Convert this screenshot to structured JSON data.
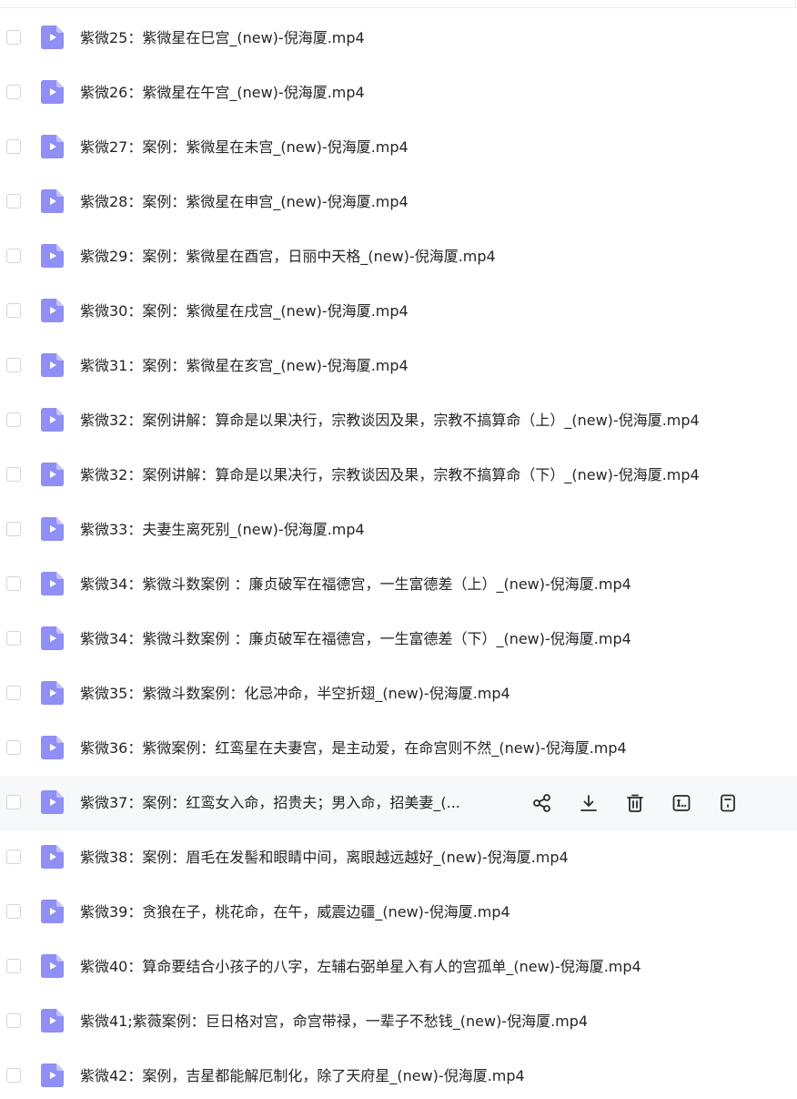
{
  "files": [
    {
      "name": "紫微25：紫微星在巳宫_(new)-倪海厦.mp4"
    },
    {
      "name": "紫微26：紫微星在午宫_(new)-倪海厦.mp4"
    },
    {
      "name": "紫微27：案例：紫微星在未宫_(new)-倪海厦.mp4"
    },
    {
      "name": "紫微28：案例：紫微星在申宫_(new)-倪海厦.mp4"
    },
    {
      "name": "紫微29：案例：紫微星在酉宫，日丽中天格_(new)-倪海厦.mp4"
    },
    {
      "name": "紫微30：案例：紫微星在戌宫_(new)-倪海厦.mp4"
    },
    {
      "name": "紫微31：案例：紫微星在亥宫_(new)-倪海厦.mp4"
    },
    {
      "name": "紫微32：案例讲解：算命是以果决行，宗教谈因及果，宗教不搞算命（上）_(new)-倪海厦.mp4"
    },
    {
      "name": "紫微32：案例讲解：算命是以果决行，宗教谈因及果，宗教不搞算命（下）_(new)-倪海厦.mp4"
    },
    {
      "name": "紫微33：夫妻生离死别_(new)-倪海厦.mp4"
    },
    {
      "name": "紫微34：紫微斗数案例 ：廉贞破军在福德宫，一生富德差（上）_(new)-倪海厦.mp4"
    },
    {
      "name": "紫微34：紫微斗数案例 ：廉贞破军在福德宫，一生富德差（下）_(new)-倪海厦.mp4"
    },
    {
      "name": "紫微35：紫微斗数案例：化忌冲命，半空折翅_(new)-倪海厦.mp4"
    },
    {
      "name": "紫微36：紫微案例：红鸾星在夫妻宫，是主动爱，在命宫则不然_(new)-倪海厦.mp4"
    },
    {
      "name": "紫微37：案例：红鸾女入命，招贵夫；男入命，招美妻_(..."
    },
    {
      "name": "紫微38：案例：眉毛在发髻和眼睛中间，离眼越远越好_(new)-倪海厦.mp4"
    },
    {
      "name": "紫微39：贪狼在子，桃花命，在午，威震边疆_(new)-倪海厦.mp4"
    },
    {
      "name": "紫微40：算命要结合小孩子的八字，左辅右弼单星入有人的宫孤单_(new)-倪海厦.mp4"
    },
    {
      "name": "紫微41;紫薇案例：巨日格对宫，命宫带禄，一辈子不愁钱_(new)-倪海厦.mp4"
    },
    {
      "name": "紫微42：案例，吉星都能解厄制化，除了天府星_(new)-倪海厦.mp4"
    }
  ],
  "hovered_row_index": 14,
  "row_actions": [
    "share-icon",
    "download-icon",
    "delete-icon",
    "rename-icon",
    "details-icon"
  ],
  "colors": {
    "icon_bg": "#8f8ff5",
    "icon_fold": "#c3c3fb",
    "icon_play": "#ffffff",
    "text": "#25262b",
    "action_icon": "#2b2b2b",
    "hover_bg": "#f7f8fa",
    "checkbox_border": "#d2d4d9"
  }
}
